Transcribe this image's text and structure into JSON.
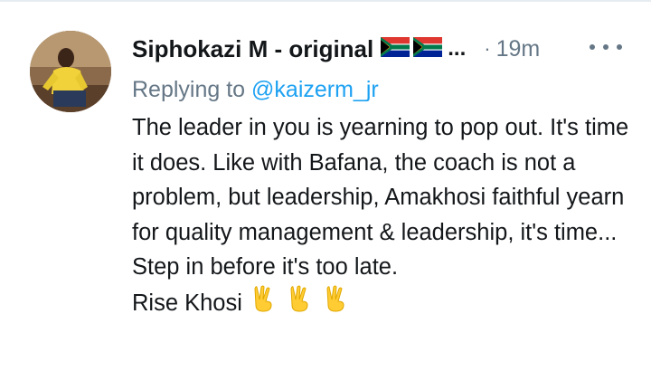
{
  "tweet": {
    "author_name": "Siphokazi M - original",
    "flags": [
      "south-africa-flag",
      "south-africa-flag"
    ],
    "ellipsis": "...",
    "dot": "·",
    "time": "19m",
    "replying_prefix": "Replying to ",
    "reply_handle": "@kaizerm_jr",
    "body": "The leader in you is yearning to pop out. It's time it does. Like with Bafana, the coach is not a problem, but leadership, Amakhosi faithful yearn for quality management & leadership, it's time... Step in before it's too late.",
    "sign_off": "Rise Khosi",
    "sign_emojis": [
      "victory-hand-emoji",
      "victory-hand-emoji",
      "victory-hand-emoji"
    ]
  },
  "colors": {
    "text": "#14171a",
    "muted": "#657786",
    "link": "#1da1f2"
  }
}
